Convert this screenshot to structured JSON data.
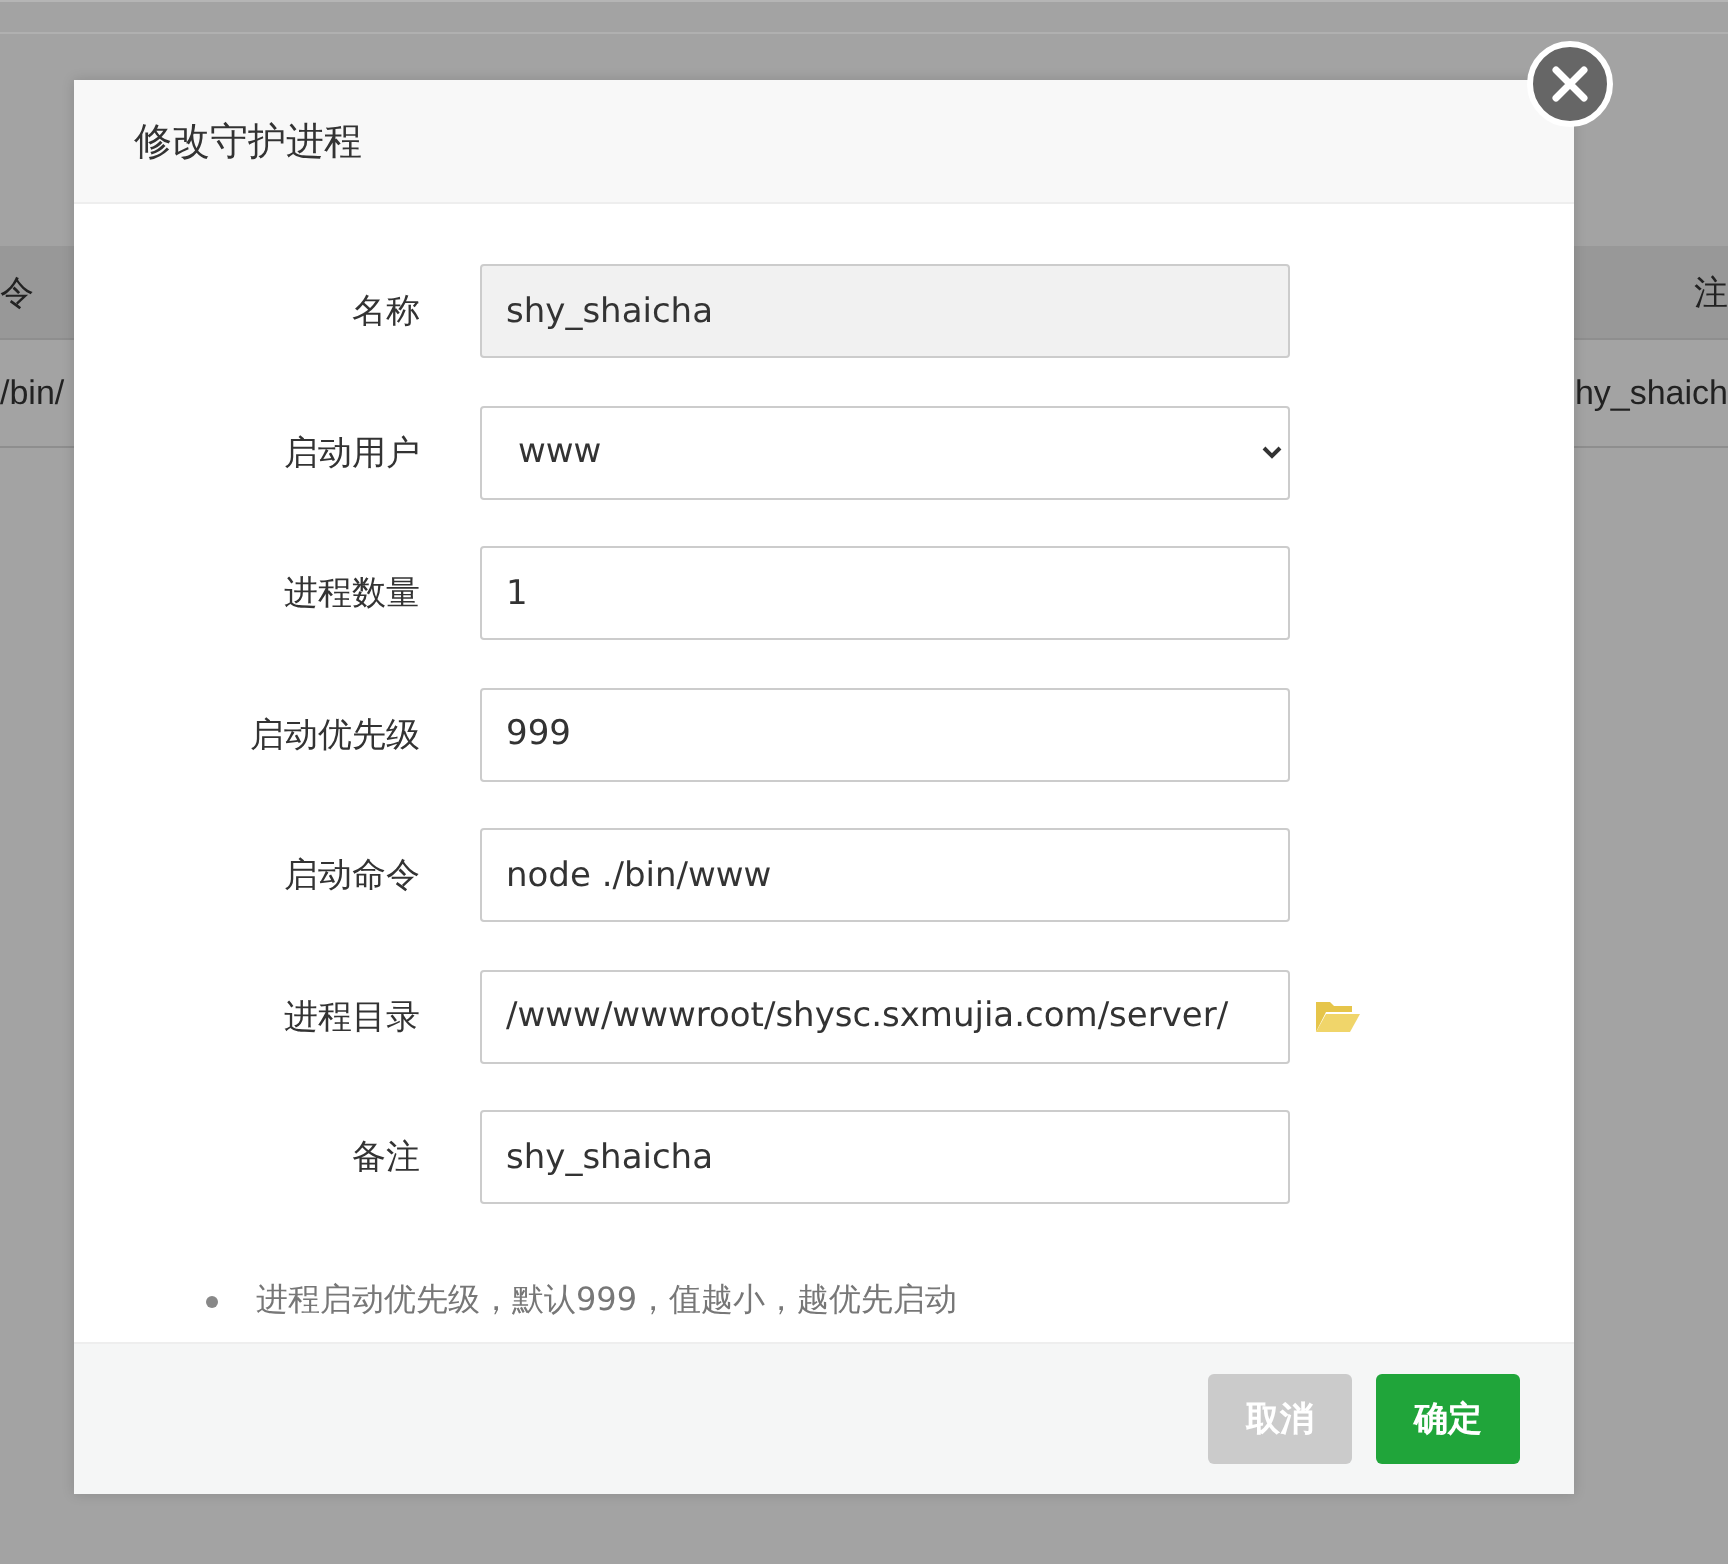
{
  "background_table": {
    "columns": [
      "令",
      "注"
    ],
    "rows": [
      [
        "/bin/",
        "hy_shaich"
      ]
    ]
  },
  "dialog": {
    "title": "修改守护进程",
    "fields": [
      {
        "label": "名称",
        "kind": "readonly",
        "value": "shy_shaicha"
      },
      {
        "label": "启动用户",
        "kind": "select",
        "value": "www"
      },
      {
        "label": "进程数量",
        "kind": "text",
        "value": "1"
      },
      {
        "label": "启动优先级",
        "kind": "text",
        "value": "999"
      },
      {
        "label": "启动命令",
        "kind": "text",
        "value": "node ./bin/www"
      },
      {
        "label": "进程目录",
        "kind": "folder",
        "value": "/www/wwwroot/shysc.sxmujia.com/server/"
      },
      {
        "label": "备注",
        "kind": "text",
        "value": "shy_shaicha"
      }
    ],
    "note": "进程启动优先级，默认999，值越小，越优先启动",
    "buttons": [
      {
        "label": "取消",
        "kind": "cancel"
      },
      {
        "label": "确定",
        "kind": "primary"
      }
    ]
  }
}
